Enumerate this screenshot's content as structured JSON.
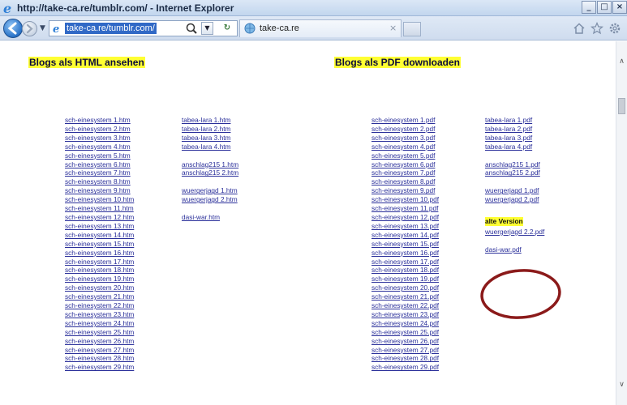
{
  "window": {
    "title": "http://take-ca.re/tumblr.com/ - Internet Explorer",
    "minimize": "_",
    "maximize": "□",
    "close": "×"
  },
  "nav": {
    "address": "take-ca.re/tumblr.com/",
    "tab_label": "take-ca.re",
    "tab_close": "×"
  },
  "headings": {
    "html": "Blogs als HTML ansehen",
    "pdf": "Blogs als PDF downloaden"
  },
  "html_col1": [
    "sch-einesystem 1.htm",
    "sch-einesystem 2.htm",
    "sch-einesystem 3.htm",
    "sch-einesystem 4.htm",
    "sch-einesystem 5.htm",
    "sch-einesystem 6.htm",
    "sch-einesystem 7.htm",
    "sch-einesystem 8.htm",
    "sch-einesystem 9.htm",
    "sch-einesystem 10.htm",
    "sch-einesystem 11.htm",
    "sch-einesystem 12.htm",
    "sch-einesystem 13.htm",
    "sch-einesystem 14.htm",
    "sch-einesystem 15.htm",
    "sch-einesystem 16.htm",
    "sch-einesystem 17.htm",
    "sch-einesystem 18.htm",
    "sch-einesystem 19.htm",
    "sch-einesystem 20.htm",
    "sch-einesystem 21.htm",
    "sch-einesystem 22.htm",
    "sch-einesystem 23.htm",
    "sch-einesystem 24.htm",
    "sch-einesystem 25.htm",
    "sch-einesystem 26.htm",
    "sch-einesystem 27.htm",
    "sch-einesystem 28.htm",
    "sch-einesystem 29.htm"
  ],
  "html_col2": {
    "tabea": [
      "tabea-lara 1.htm",
      "tabea-lara 2.htm",
      "tabea-lara 3.htm",
      "tabea-lara 4.htm"
    ],
    "anschlag": [
      "anschlag215 1.htm",
      "anschlag215 2.htm"
    ],
    "wuerger": [
      "wuergerjagd 1.htm",
      "wuergerjagd 2.htm"
    ],
    "dasi": "dasi-war.htm"
  },
  "pdf_col1": [
    "sch-einesystem 1.pdf",
    "sch-einesystem 2.pdf",
    "sch-einesystem 3.pdf",
    "sch-einesystem 4.pdf",
    "sch-einesystem 5.pdf",
    "sch-einesystem 6.pdf",
    "sch-einesystem 7.pdf",
    "sch-einesystem 8.pdf",
    "sch-einesystem 9.pdf",
    "sch-einesystem 10.pdf",
    "sch-einesystem 11.pdf",
    "sch-einesystem 12.pdf",
    "sch-einesystem 13.pdf",
    "sch-einesystem 14.pdf",
    "sch-einesystem 15.pdf",
    "sch-einesystem 16.pdf",
    "sch-einesystem 17.pdf",
    "sch-einesystem 18.pdf",
    "sch-einesystem 19.pdf",
    "sch-einesystem 20.pdf",
    "sch-einesystem 21.pdf",
    "sch-einesystem 22.pdf",
    "sch-einesystem 23.pdf",
    "sch-einesystem 24.pdf",
    "sch-einesystem 25.pdf",
    "sch-einesystem 26.pdf",
    "sch-einesystem 27.pdf",
    "sch-einesystem 28.pdf",
    "sch-einesystem 29.pdf"
  ],
  "pdf_col2": {
    "tabea": [
      "tabea-lara 1.pdf",
      "tabea-lara 2.pdf",
      "tabea-lara 3.pdf",
      "tabea-lara 4.pdf"
    ],
    "anschlag": [
      "anschlag215 1.pdf",
      "anschlag215 2.pdf"
    ],
    "wuerger": [
      "wuergerjagd 1.pdf",
      "wuergerjagd 2.pdf"
    ],
    "alt_label": "alte Version",
    "alt_link": "wuergerjagd 2.2.pdf",
    "dasi": "dasi-war.pdf"
  },
  "colors": {
    "highlight": "#ffff33",
    "link": "#2a2f9a",
    "annotation": "#8b1a1a"
  }
}
